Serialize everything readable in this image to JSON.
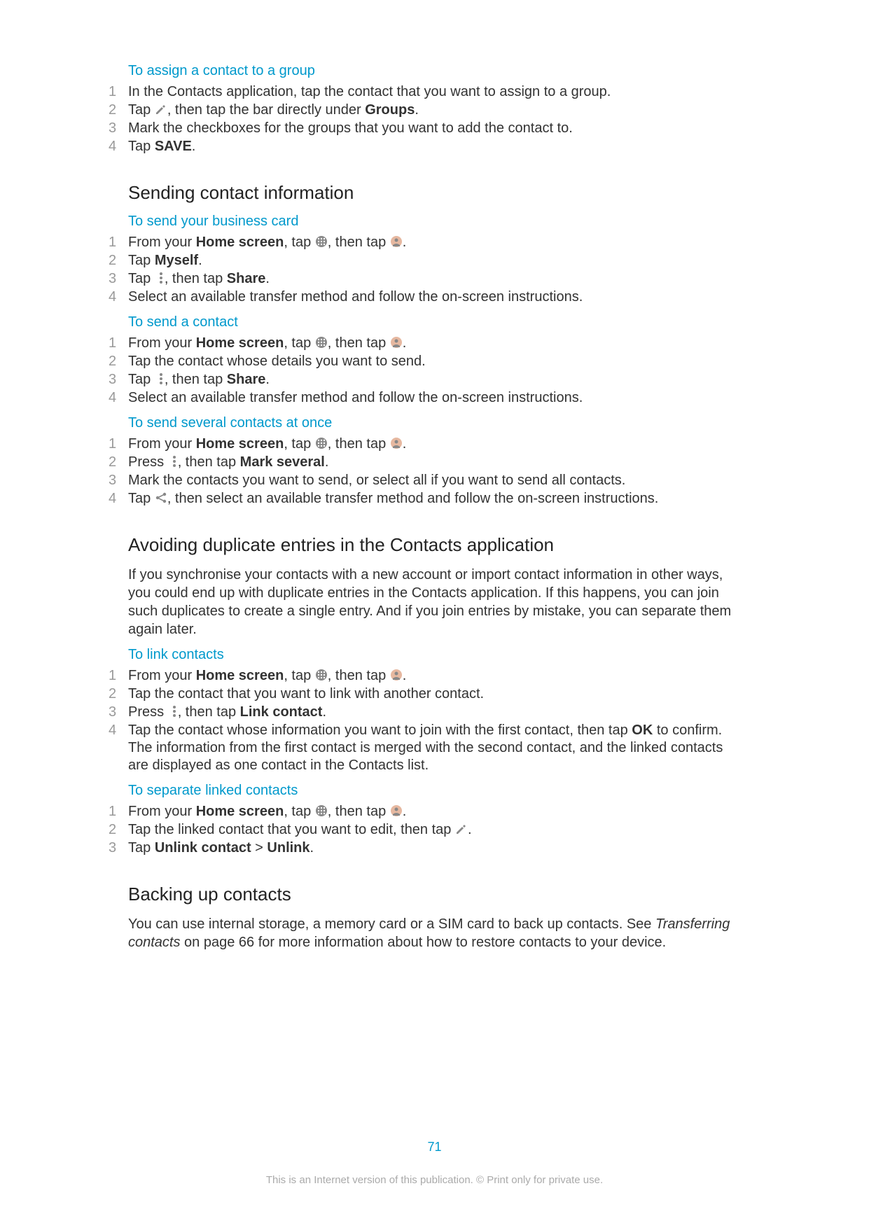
{
  "page_number": "71",
  "footer_disclaimer": "This is an Internet version of this publication. © Print only for private use.",
  "task_assign": {
    "title": "To assign a contact to a group",
    "s1": "In the Contacts application, tap the contact that you want to assign to a group.",
    "s2a": "Tap ",
    "s2b": ", then tap the bar directly under ",
    "s2_groups": "Groups",
    "s2c": ".",
    "s3": "Mark the checkboxes for the groups that you want to add the contact to.",
    "s4a": "Tap ",
    "s4_save": "SAVE",
    "s4b": "."
  },
  "sec_sending": "Sending contact information",
  "task_bcard": {
    "title": "To send your business card",
    "s1a": "From your ",
    "s1_home": "Home screen",
    "s1b": ", tap ",
    "s1c": ", then tap ",
    "s1d": ".",
    "s2a": "Tap ",
    "s2_myself": "Myself",
    "s2b": ".",
    "s3a": "Tap ",
    "s3b": ", then tap ",
    "s3_share": "Share",
    "s3c": ".",
    "s4": "Select an available transfer method and follow the on-screen instructions."
  },
  "task_sendcontact": {
    "title": "To send a contact",
    "s1a": "From your ",
    "s1_home": "Home screen",
    "s1b": ", tap ",
    "s1c": ", then tap ",
    "s1d": ".",
    "s2": "Tap the contact whose details you want to send.",
    "s3a": "Tap ",
    "s3b": ", then tap ",
    "s3_share": "Share",
    "s3c": ".",
    "s4": "Select an available transfer method and follow the on-screen instructions."
  },
  "task_sendseveral": {
    "title": "To send several contacts at once",
    "s1a": "From your ",
    "s1_home": "Home screen",
    "s1b": ", tap ",
    "s1c": ", then tap ",
    "s1d": ".",
    "s2a": "Press ",
    "s2b": ", then tap ",
    "s2_mark": "Mark several",
    "s2c": ".",
    "s3": "Mark the contacts you want to send, or select all if you want to send all contacts.",
    "s4a": "Tap ",
    "s4b": ", then select an available transfer method and follow the on-screen instructions."
  },
  "sec_dup": "Avoiding duplicate entries in the Contacts application",
  "dup_para": "If you synchronise your contacts with a new account or import contact information in other ways, you could end up with duplicate entries in the Contacts application. If this happens, you can join such duplicates to create a single entry. And if you join entries by mistake, you can separate them again later.",
  "task_link": {
    "title": "To link contacts",
    "s1a": "From your ",
    "s1_home": "Home screen",
    "s1b": ", tap ",
    "s1c": ", then tap ",
    "s1d": ".",
    "s2": "Tap the contact that you want to link with another contact.",
    "s3a": "Press ",
    "s3b": ", then tap ",
    "s3_link": "Link contact",
    "s3c": ".",
    "s4a": "Tap the contact whose information you want to join with the first contact, then tap ",
    "s4_ok": "OK",
    "s4b": " to confirm. The information from the first contact is merged with the second contact, and the linked contacts are displayed as one contact in the Contacts list."
  },
  "task_sep": {
    "title": "To separate linked contacts",
    "s1a": "From your ",
    "s1_home": "Home screen",
    "s1b": ", tap ",
    "s1c": ", then tap ",
    "s1d": ".",
    "s2a": "Tap the linked contact that you want to edit, then tap ",
    "s2b": ".",
    "s3a": "Tap ",
    "s3_unlinkc": "Unlink contact",
    "s3_gt": " > ",
    "s3_unlink": "Unlink",
    "s3b": "."
  },
  "sec_backup": "Backing up contacts",
  "backup_a": "You can use internal storage, a memory card or a SIM card to back up contacts. See ",
  "backup_link": "Transferring contacts",
  "backup_b": " on page 66 for more information about how to restore contacts to your device."
}
